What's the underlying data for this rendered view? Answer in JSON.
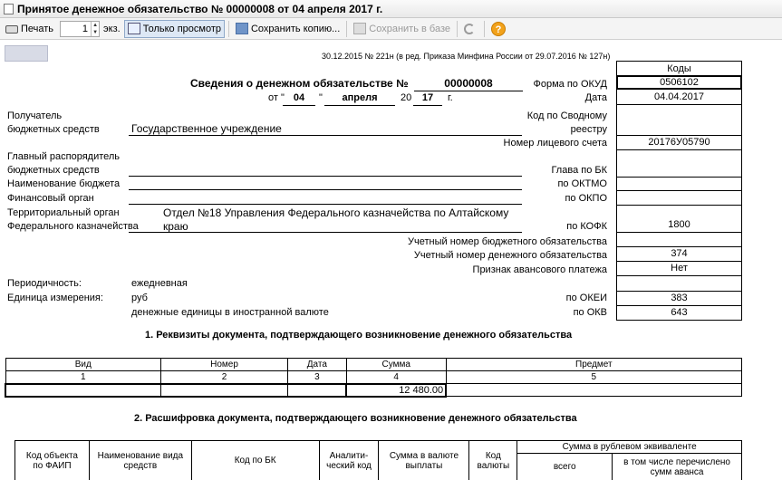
{
  "window": {
    "title": "Принятое денежное обязательство № 00000008 от 04 апреля 2017 г."
  },
  "toolbar": {
    "print_label": "Печать",
    "copies_value": "1",
    "copies_unit": "экз.",
    "view_only_label": "Только просмотр",
    "save_copy_label": "Сохранить копию...",
    "save_db_label": "Сохранить в базе",
    "help_glyph": "?"
  },
  "doc": {
    "header_note": "30.12.2015 № 221н (в ред. Приказа Минфина России от 29.07.2016 № 127н)",
    "codes_header": "Коды",
    "title": "Сведения о денежном обязательстве №",
    "number": "00000008",
    "date_prefix": "от \"",
    "day": "04",
    "date_quote": "\"",
    "month": "апреля",
    "year_prefix": "20",
    "year": "17",
    "year_suffix": "г.",
    "recipient_label_1": "Получатель",
    "recipient_label_2": "бюджетных средств",
    "recipient_value": "Государственное учреждение",
    "main_manager_1": "Главный распорядитель",
    "main_manager_2": "бюджетных средств",
    "budget_name": "Наименование бюджета",
    "fin_organ": "Финансовый орган",
    "terr_organ_1": "Территориальный орган",
    "terr_organ_2": "Федерального казначейства",
    "terr_value_1": "Отдел №18 Управления Федерального казначейства по Алтайскому",
    "terr_value_2": "краю",
    "periodicity_label": "Периодичность:",
    "periodicity_value": "ежедневная",
    "unit_label": "Единица измерения:",
    "unit_value": "руб",
    "currency_note": "денежные единицы в иностранной валюте",
    "codes": [
      {
        "label": "Форма по ОКУД",
        "value": "0506102"
      },
      {
        "label": "Дата",
        "value": "04.04.2017"
      },
      {
        "label": "Код по Сводному реестру",
        "value": ""
      },
      {
        "label": "Номер лицевого счета",
        "value": "20176У05790"
      },
      {
        "label": "Глава по БК",
        "value": ""
      },
      {
        "label": "по ОКТМО",
        "value": ""
      },
      {
        "label": "по ОКПО",
        "value": ""
      },
      {
        "label": "по КОФК",
        "value": "1800"
      },
      {
        "label": "Учетный номер бюджетного обязательства",
        "value": ""
      },
      {
        "label": "Учетный номер денежного обязательства",
        "value": "374"
      },
      {
        "label": "Признак авансового платежа",
        "value": "Нет"
      },
      {
        "label": "по ОКЕИ",
        "value": "383"
      },
      {
        "label": "по ОКВ",
        "value": "643"
      }
    ],
    "reestr_label_1": "Код по Сводному",
    "reestr_label_2": "реестру",
    "section1_title": "1. Реквизиты документа, подтверждающего возникновение денежного обязательства",
    "section1_table": {
      "headers": [
        "Вид",
        "Номер",
        "Дата",
        "Сумма",
        "Предмет"
      ],
      "numbers": [
        "1",
        "2",
        "3",
        "4",
        "5"
      ],
      "row": [
        "",
        "",
        "",
        "12 480.00",
        ""
      ]
    },
    "section2_title": "2. Расшифровка документа, подтверждающего возникновение денежного обязательства",
    "section2_table": {
      "col1_a": "Код объекта",
      "col1_b": "по ФАИП",
      "col2_a": "Наименование вида",
      "col2_b": "средств",
      "col3": "Код по БК",
      "col4_a": "Аналити-",
      "col4_b": "ческий код",
      "col5_a": "Сумма в валюте",
      "col5_b": "выплаты",
      "col6_a": "Код",
      "col6_b": "валюты",
      "group": "Сумма в рублевом эквиваленте",
      "sub1": "всего",
      "sub2_a": "в том числе перечислено",
      "sub2_b": "сумм аванса"
    }
  }
}
